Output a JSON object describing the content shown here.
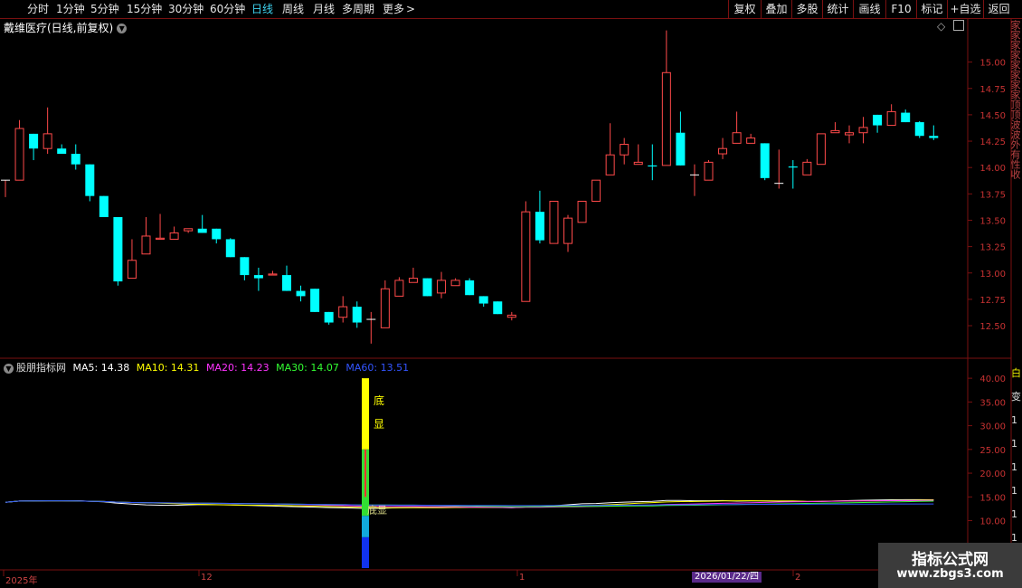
{
  "toolbar": {
    "timeframes": [
      {
        "label": "分时",
        "active": false
      },
      {
        "label": "1分钟",
        "active": false
      },
      {
        "label": "5分钟",
        "active": false
      },
      {
        "label": "15分钟",
        "active": false
      },
      {
        "label": "30分钟",
        "active": false
      },
      {
        "label": "60分钟",
        "active": false
      },
      {
        "label": "日线",
        "active": true
      },
      {
        "label": "周线",
        "active": false
      },
      {
        "label": "月线",
        "active": false
      },
      {
        "label": "多周期",
        "active": false
      },
      {
        "label": "更多",
        "active": false
      }
    ],
    "more_arrow": ">",
    "right_buttons": [
      "复权",
      "叠加",
      "多股",
      "统计",
      "画线",
      "F10",
      "标记",
      "+自选",
      "返回"
    ]
  },
  "chart": {
    "title": "戴维医疗(日线,前复权)",
    "diamond_icon": "◇",
    "price_axis": [
      "15.00",
      "14.75",
      "14.50",
      "14.25",
      "14.00",
      "13.75",
      "13.50",
      "13.25",
      "13.00",
      "12.75",
      "12.50"
    ],
    "right_glyphs": "家家家家家家家家顶顶波波外有性收"
  },
  "indicator": {
    "name": "股朋指标网",
    "ma": [
      {
        "label": "MA5: 14.38",
        "color": "#ffffff"
      },
      {
        "label": "MA10: 14.31",
        "color": "#ffff00"
      },
      {
        "label": "MA20: 14.23",
        "color": "#ff33ff"
      },
      {
        "label": "MA30: 14.07",
        "color": "#33ff33"
      },
      {
        "label": "MA60: 13.51",
        "color": "#3355ff"
      }
    ],
    "axis": [
      "40.00",
      "35.00",
      "30.00",
      "25.00",
      "20.00",
      "15.00",
      "10.00"
    ],
    "signal_texts": [
      "底",
      "显"
    ],
    "overlap_text": "底显",
    "right_values": [
      "白",
      "变",
      "1",
      "1",
      "1",
      "1",
      "1",
      "1",
      "1"
    ]
  },
  "time_axis": {
    "labels": [
      "2025年",
      "12",
      "1",
      "2"
    ],
    "date_badge": "2026/01/22/四"
  },
  "watermark": {
    "line1": "指标公式网",
    "line2": "www.zbgs3.com"
  },
  "colors": {
    "up": "#ff4a4a",
    "down": "#00ffff",
    "grid": "#7a1010",
    "axis_text": "#c83232"
  },
  "chart_data": {
    "type": "candlestick",
    "title": "戴维医疗(日线,前复权)",
    "ylim": [
      12.2,
      15.4
    ],
    "candles": [
      [
        13.88,
        13.88,
        13.72,
        13.88
      ],
      [
        13.88,
        14.37,
        14.45,
        13.88
      ],
      [
        14.32,
        14.18,
        14.32,
        14.07
      ],
      [
        14.18,
        14.32,
        14.57,
        14.13
      ],
      [
        14.18,
        14.13,
        14.22,
        14.13
      ],
      [
        14.13,
        14.03,
        14.22,
        13.98
      ],
      [
        14.03,
        13.73,
        14.03,
        13.68
      ],
      [
        13.73,
        13.53,
        13.73,
        13.53
      ],
      [
        13.53,
        12.92,
        13.53,
        12.88
      ],
      [
        12.95,
        13.12,
        13.32,
        12.95
      ],
      [
        13.18,
        13.35,
        13.53,
        13.18
      ],
      [
        13.32,
        13.33,
        13.56,
        13.32
      ],
      [
        13.32,
        13.38,
        13.44,
        13.32
      ],
      [
        13.4,
        13.42,
        13.42,
        13.38
      ],
      [
        13.42,
        13.38,
        13.55,
        13.38
      ],
      [
        13.42,
        13.32,
        13.42,
        13.28
      ],
      [
        13.32,
        13.15,
        13.33,
        13.15
      ],
      [
        13.15,
        12.98,
        13.15,
        12.93
      ],
      [
        12.98,
        12.95,
        13.05,
        12.83
      ],
      [
        12.98,
        12.99,
        13.02,
        12.98
      ],
      [
        12.98,
        12.83,
        13.07,
        12.83
      ],
      [
        12.83,
        12.78,
        12.88,
        12.73
      ],
      [
        12.85,
        12.63,
        12.85,
        12.63
      ],
      [
        12.63,
        12.53,
        12.63,
        12.51
      ],
      [
        12.58,
        12.68,
        12.78,
        12.53
      ],
      [
        12.68,
        12.53,
        12.73,
        12.48
      ],
      [
        12.56,
        12.56,
        12.63,
        12.33
      ],
      [
        12.48,
        12.85,
        12.93,
        12.48
      ],
      [
        12.78,
        12.93,
        12.96,
        12.78
      ],
      [
        12.91,
        12.95,
        13.05,
        12.91
      ],
      [
        12.95,
        12.78,
        12.95,
        12.78
      ],
      [
        12.81,
        12.93,
        13.01,
        12.76
      ],
      [
        12.88,
        12.93,
        12.95,
        12.88
      ],
      [
        12.93,
        12.79,
        12.95,
        12.79
      ],
      [
        12.78,
        12.71,
        12.78,
        12.68
      ],
      [
        12.73,
        12.61,
        12.73,
        12.61
      ],
      [
        12.58,
        12.6,
        12.63,
        12.55
      ],
      [
        12.73,
        13.58,
        13.68,
        12.73
      ],
      [
        13.58,
        13.31,
        13.78,
        13.28
      ],
      [
        13.28,
        13.68,
        13.68,
        13.28
      ],
      [
        13.28,
        13.52,
        13.55,
        13.2
      ],
      [
        13.48,
        13.68,
        13.68,
        13.48
      ],
      [
        13.68,
        13.88,
        13.88,
        13.68
      ],
      [
        13.93,
        14.12,
        14.42,
        13.93
      ],
      [
        14.12,
        14.22,
        14.28,
        14.03
      ],
      [
        14.03,
        14.05,
        14.22,
        14.03
      ],
      [
        14.02,
        14.01,
        14.22,
        13.88
      ],
      [
        14.02,
        14.9,
        15.3,
        14.02
      ],
      [
        14.33,
        14.02,
        14.53,
        14.02
      ],
      [
        13.93,
        13.93,
        14.03,
        13.73
      ],
      [
        13.88,
        14.05,
        14.07,
        13.88
      ],
      [
        14.13,
        14.18,
        14.28,
        14.08
      ],
      [
        14.23,
        14.33,
        14.53,
        14.23
      ],
      [
        14.23,
        14.28,
        14.32,
        14.23
      ],
      [
        14.23,
        13.9,
        14.23,
        13.88
      ],
      [
        13.85,
        13.85,
        14.17,
        13.8
      ],
      [
        14.01,
        14.0,
        14.07,
        13.8
      ],
      [
        13.93,
        14.05,
        14.08,
        13.93
      ],
      [
        14.03,
        14.32,
        14.32,
        14.03
      ],
      [
        14.33,
        14.35,
        14.43,
        14.33
      ],
      [
        14.31,
        14.33,
        14.4,
        14.23
      ],
      [
        14.33,
        14.38,
        14.48,
        14.23
      ],
      [
        14.5,
        14.4,
        14.5,
        14.33
      ],
      [
        14.4,
        14.53,
        14.6,
        14.4
      ],
      [
        14.52,
        14.43,
        14.55,
        14.43
      ],
      [
        14.43,
        14.3,
        14.44,
        14.28
      ],
      [
        14.3,
        14.28,
        14.4,
        14.26
      ]
    ]
  }
}
